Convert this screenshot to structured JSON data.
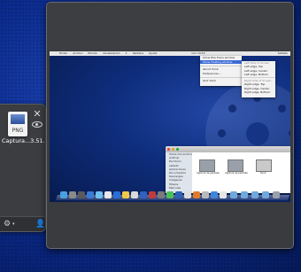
{
  "panel": {
    "file_name": "Captura...3.51.png",
    "file_ext": "PNG",
    "close_glyph": "✕",
    "gear_glyph": "⚙",
    "caret_glyph": "▾",
    "person_glyph": "👤"
  },
  "shot": {
    "menubar": {
      "apple": "",
      "items": [
        "Finder",
        "Archivo",
        "Edición",
        "Visualización",
        "Ir",
        "Ventana",
        "Ayuda"
      ],
      "clock": "mar 19:53",
      "user": "Sefasto"
    },
    "menu1": [
      "Show Fiile Trans window",
      "Show Floating window",
      "About Yoink",
      "Preferences...",
      "Quit Yoink"
    ],
    "menu2": [
      "Left Side of Screen",
      "Left edge, Top",
      "Left edge, Center",
      "Left edge, Bottom",
      "Right Side of Screen",
      "Right edge, Top",
      "Right edge, Center",
      "Right edge, Bottom"
    ],
    "finder": {
      "sidebar": [
        "Todos mis archivos",
        "AirDrop",
        "Escritorio",
        "sefasto",
        "Aplicaciones",
        "Documentos",
        "Descargas",
        "Imágenes",
        "Música",
        "Películas"
      ],
      "files": [
        "Captura de pantalla",
        "Captura de pantalla",
        "Yoink"
      ]
    }
  }
}
